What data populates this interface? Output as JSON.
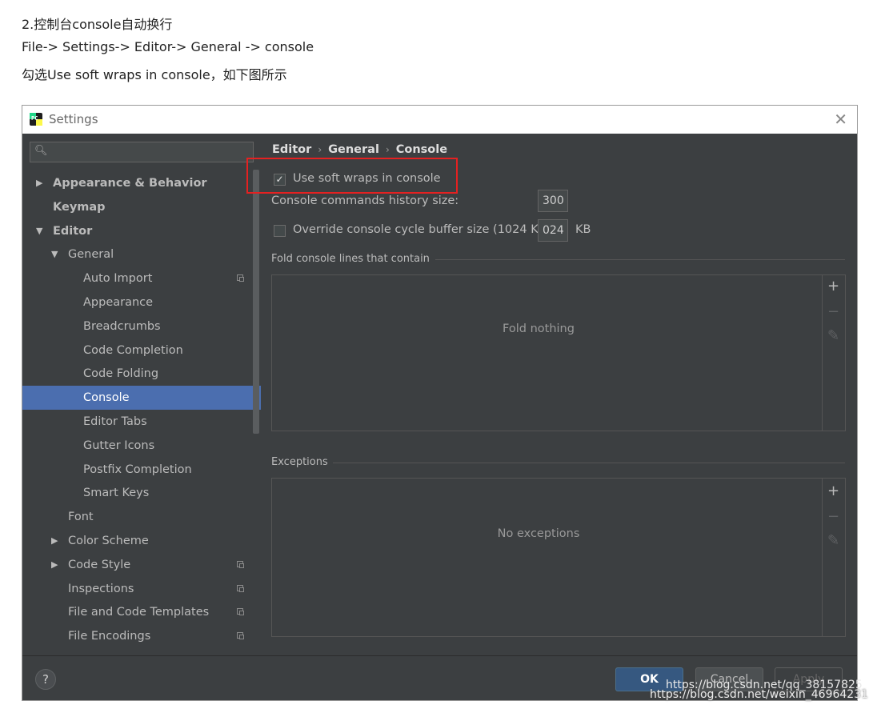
{
  "article": {
    "line1": "2.控制台console自动换行",
    "line2": "File-> Settings-> Editor-> General -> console",
    "line3": "勾选Use soft wraps in console，如下图所示"
  },
  "window": {
    "title": "Settings",
    "app_icon": "pycharm-icon",
    "close_glyph": "✕"
  },
  "sidebar": {
    "search": {
      "value": "",
      "placeholder": "",
      "icon": "search-icon"
    },
    "items": [
      {
        "label": "Appearance & Behavior",
        "bold": true,
        "arrow": "▶"
      },
      {
        "label": "Keymap",
        "bold": true,
        "arrow": ""
      },
      {
        "label": "Editor",
        "bold": true,
        "arrow": "▼"
      },
      {
        "label": "General",
        "bold": false,
        "arrow": "▼"
      },
      {
        "label": "Auto Import",
        "bold": false,
        "arrow": "",
        "copy": true
      },
      {
        "label": "Appearance",
        "bold": false,
        "arrow": ""
      },
      {
        "label": "Breadcrumbs",
        "bold": false,
        "arrow": ""
      },
      {
        "label": "Code Completion",
        "bold": false,
        "arrow": ""
      },
      {
        "label": "Code Folding",
        "bold": false,
        "arrow": ""
      },
      {
        "label": "Console",
        "bold": false,
        "arrow": "",
        "selected": true
      },
      {
        "label": "Editor Tabs",
        "bold": false,
        "arrow": ""
      },
      {
        "label": "Gutter Icons",
        "bold": false,
        "arrow": ""
      },
      {
        "label": "Postfix Completion",
        "bold": false,
        "arrow": ""
      },
      {
        "label": "Smart Keys",
        "bold": false,
        "arrow": ""
      },
      {
        "label": "Font",
        "bold": false,
        "arrow": ""
      },
      {
        "label": "Color Scheme",
        "bold": false,
        "arrow": "▶"
      },
      {
        "label": "Code Style",
        "bold": false,
        "arrow": "▶",
        "copy": true
      },
      {
        "label": "Inspections",
        "bold": false,
        "arrow": "",
        "copy": true
      },
      {
        "label": "File and Code Templates",
        "bold": false,
        "arrow": "",
        "copy": true
      },
      {
        "label": "File Encodings",
        "bold": false,
        "arrow": "",
        "copy": true
      }
    ]
  },
  "content": {
    "breadcrumb": [
      "Editor",
      "General",
      "Console"
    ],
    "breadcrumb_sep": "›",
    "soft_wrap": {
      "label": "Use soft wraps in console",
      "checked": true
    },
    "history_size": {
      "label": "Console commands history size:",
      "value": "300"
    },
    "cycle_buffer": {
      "label": "Override console cycle buffer size (1024 KB)",
      "checked": false,
      "value": "024",
      "unit": "KB"
    },
    "fold": {
      "title": "Fold console lines that contain",
      "empty_text": "Fold nothing"
    },
    "exceptions": {
      "title": "Exceptions",
      "empty_text": "No exceptions"
    },
    "tools": {
      "add": "+",
      "remove": "−",
      "edit": "✎"
    }
  },
  "footer": {
    "help": "?",
    "ok": "OK",
    "cancel": "Cancel",
    "apply": "Apply"
  },
  "watermarks": {
    "inner": "https://blog.csdn.net/qq_38157825",
    "outer": "https://blog.csdn.net/weixin_46964231"
  },
  "colors": {
    "window_bg": "#3c3f41",
    "selection": "#4b6eaf",
    "highlight_box": "#e52121",
    "ok_button": "#365880"
  }
}
